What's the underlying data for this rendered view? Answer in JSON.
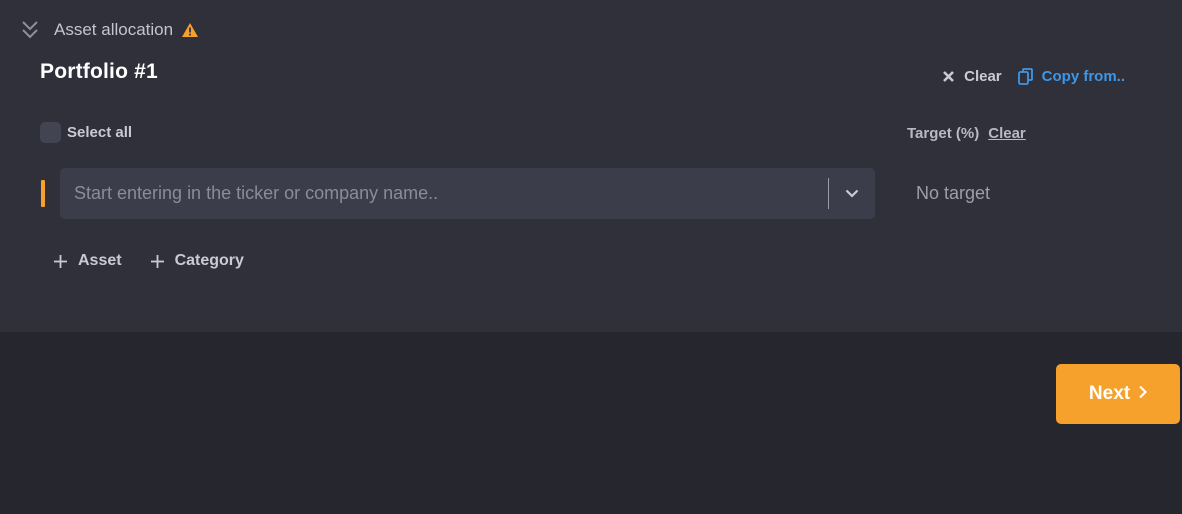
{
  "section": {
    "title": "Asset allocation",
    "collapse_icon": "double-chevron-down-icon",
    "status_icon": "warning-icon",
    "warning_color": "#f5a12b"
  },
  "portfolio": {
    "title": "Portfolio #1",
    "actions": {
      "clear_label": "Clear",
      "copy_label": "Copy from.."
    }
  },
  "list": {
    "select_all_label": "Select all",
    "target_header": "Target (%)",
    "target_clear_label": "Clear"
  },
  "asset_row": {
    "ticker_input": {
      "value": "",
      "placeholder": "Start entering in the ticker or company name.."
    },
    "target_text": "No target"
  },
  "add_actions": {
    "asset_label": "Asset",
    "category_label": "Category"
  },
  "footer": {
    "next_label": "Next"
  },
  "colors": {
    "accent": "#f5a12b",
    "link": "#3d97e8",
    "panel_bg": "#30303b",
    "page_bg": "#26262f"
  }
}
